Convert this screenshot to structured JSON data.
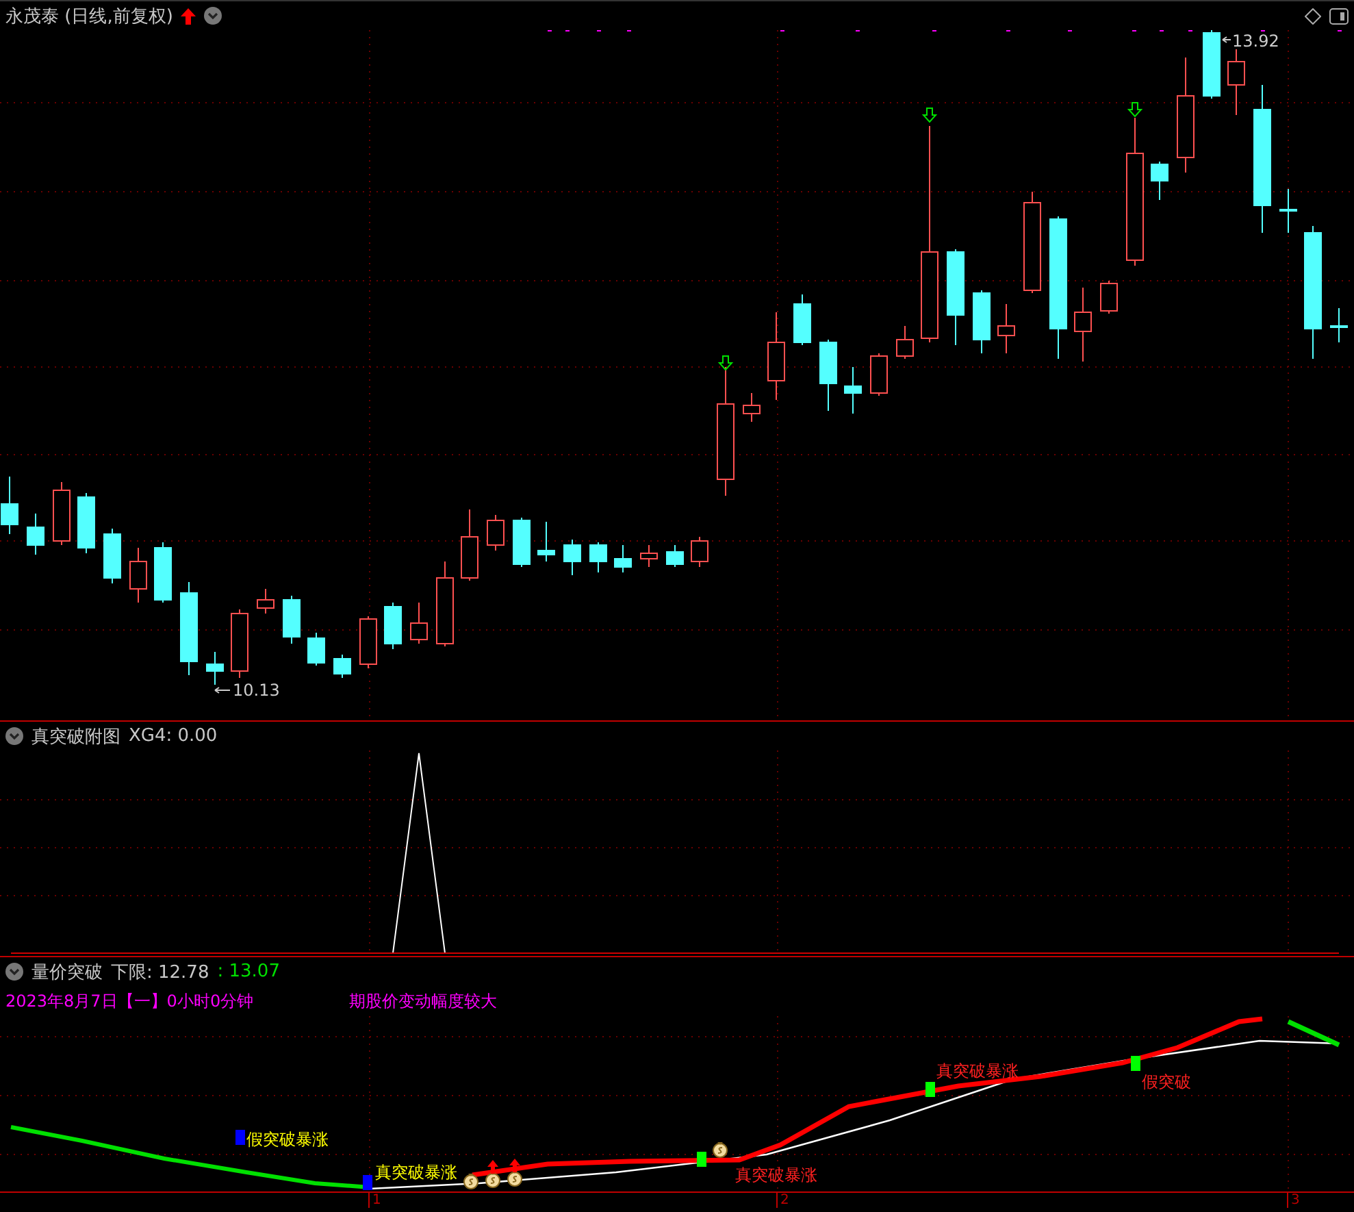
{
  "main_chart": {
    "title": "永茂泰 (日线,前复权)",
    "high_label": "13.92",
    "low_label": "10.13"
  },
  "sub_chart": {
    "title": "真突破附图",
    "reading": "XG4: 0.00"
  },
  "signal_chart": {
    "title": "量价突破",
    "lower_limit": "下限: 12.78",
    "value": ": 13.07",
    "info": [
      "2023年8月7日【一】0小时0分钟",
      "期股价变动幅度较大"
    ],
    "signals": [
      {
        "label": "假突破暴涨",
        "color": "#0000ff"
      },
      {
        "label": "真突破暴涨",
        "color": "#0000ff"
      },
      {
        "label": "真突破暴涨",
        "color": "#00ff00"
      },
      {
        "label": "真突破暴涨",
        "color": "#00ff00"
      },
      {
        "label": "假突破",
        "color": "#00ff00"
      }
    ]
  },
  "time_axis": [
    "1",
    "2",
    "3"
  ]
}
